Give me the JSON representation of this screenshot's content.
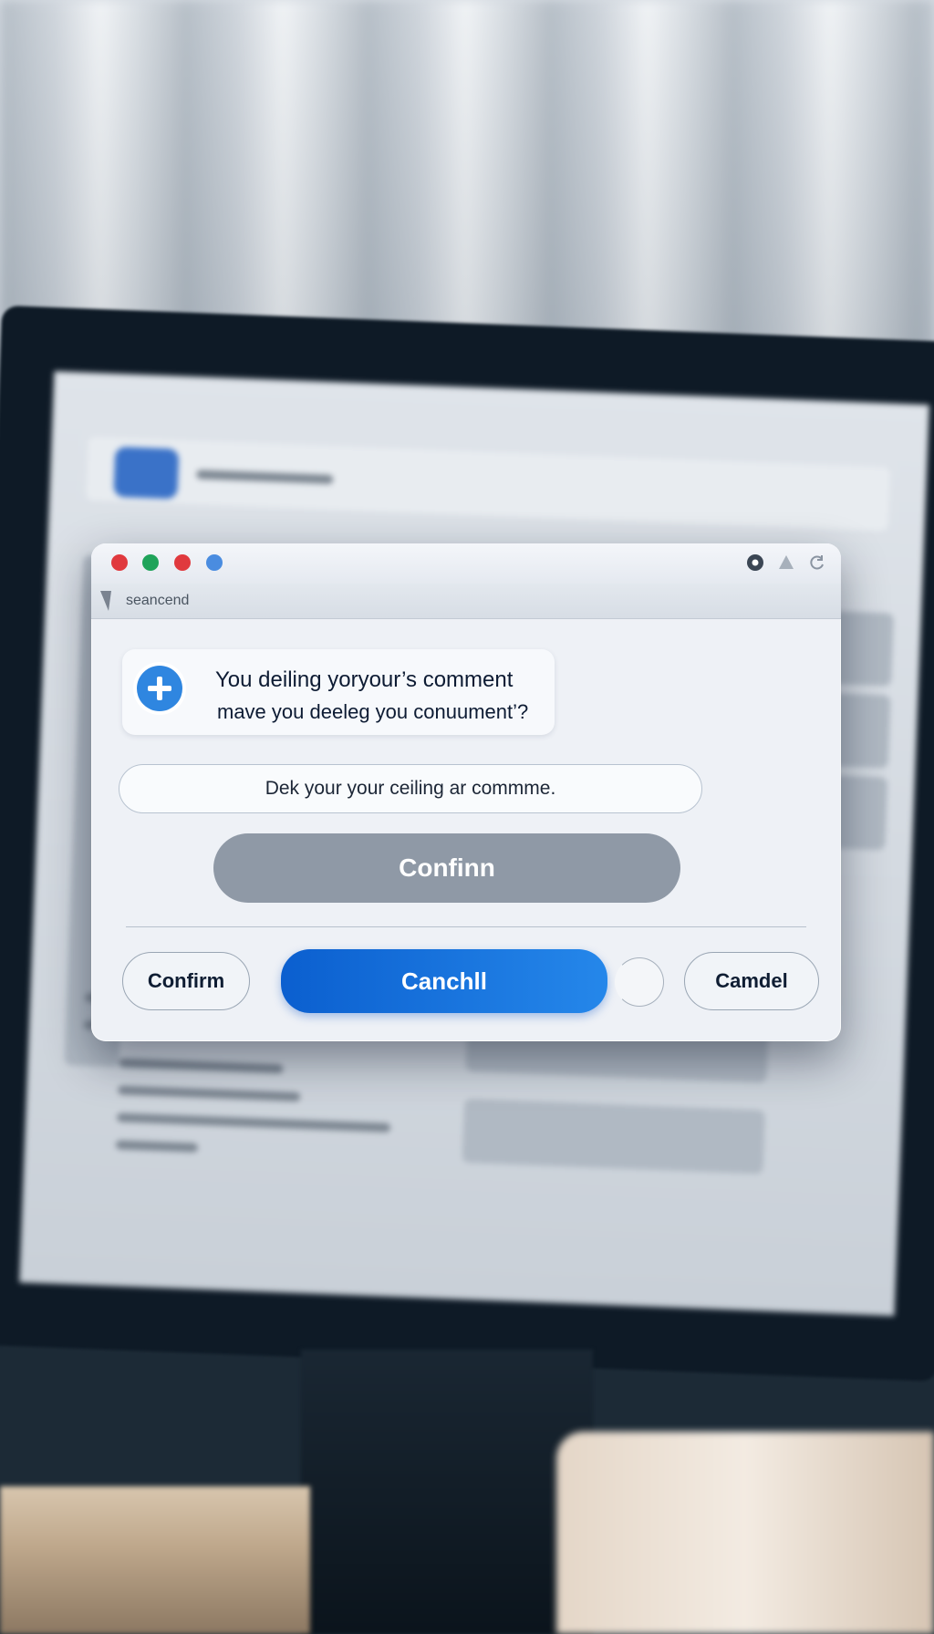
{
  "dialog": {
    "titlebar": {
      "dot_colors": [
        "#e0393e",
        "#1fa35a",
        "#e0393e",
        "#4a8ce0"
      ]
    },
    "address": {
      "text": "seancend"
    },
    "message": {
      "line1": "You deiling yoryour’s comment",
      "line2": "mave you deeleg you conuument’?"
    },
    "input": {
      "value": "Dek your your ceiling ar commme."
    },
    "confirm_large_label": "Confinn",
    "footer": {
      "confirm_label": "Confirm",
      "primary_label": "Canchll",
      "cancel_label": "Camdel"
    }
  }
}
